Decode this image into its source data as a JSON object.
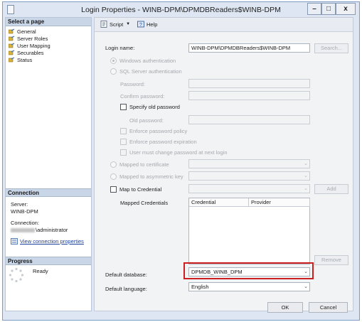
{
  "window": {
    "title": "Login Properties - WINB-DPM\\DPMDBReaders$WINB-DPM",
    "minimize": "–",
    "maximize": "□",
    "close": "x"
  },
  "sidebar": {
    "select_page_header": "Select a page",
    "pages": [
      {
        "label": "General"
      },
      {
        "label": "Server Roles"
      },
      {
        "label": "User Mapping"
      },
      {
        "label": "Securables"
      },
      {
        "label": "Status"
      }
    ],
    "connection_header": "Connection",
    "server_label": "Server:",
    "server_value": "WINB-DPM",
    "connection_label": "Connection:",
    "connection_value": "\\administrator",
    "view_connection_link": "View connection properties",
    "progress_header": "Progress",
    "progress_status": "Ready"
  },
  "toolbar": {
    "script_label": "Script",
    "help_label": "Help"
  },
  "form": {
    "login_name_label": "Login name:",
    "login_name_value": "WINB-DPM\\DPMDBReaders$WINB-DPM",
    "search_button": "Search...",
    "windows_auth": "Windows authentication",
    "sql_auth": "SQL Server authentication",
    "password_label": "Password:",
    "confirm_password_label": "Confirm password:",
    "specify_old_password": "Specify old password",
    "old_password_label": "Old password:",
    "enforce_policy": "Enforce password policy",
    "enforce_expiration": "Enforce password expiration",
    "must_change": "User must change password at next login",
    "mapped_to_certificate": "Mapped to certificate",
    "mapped_to_asymmetric_key": "Mapped to asymmetric key",
    "map_to_credential": "Map to Credential",
    "add_button": "Add",
    "mapped_credentials_label": "Mapped Credentials",
    "credentials_columns": [
      "Credential",
      "Provider"
    ],
    "remove_button": "Remove",
    "default_database_label": "Default database:",
    "default_database_value": "DPMDB_WINB_DPM",
    "default_language_label": "Default language:",
    "default_language_value": "English"
  },
  "footer": {
    "ok_button": "OK",
    "cancel_button": "Cancel"
  },
  "colors": {
    "highlight_border": "#cc1f1f",
    "window_background": "#dde6f2",
    "link": "#1b3f9c"
  }
}
